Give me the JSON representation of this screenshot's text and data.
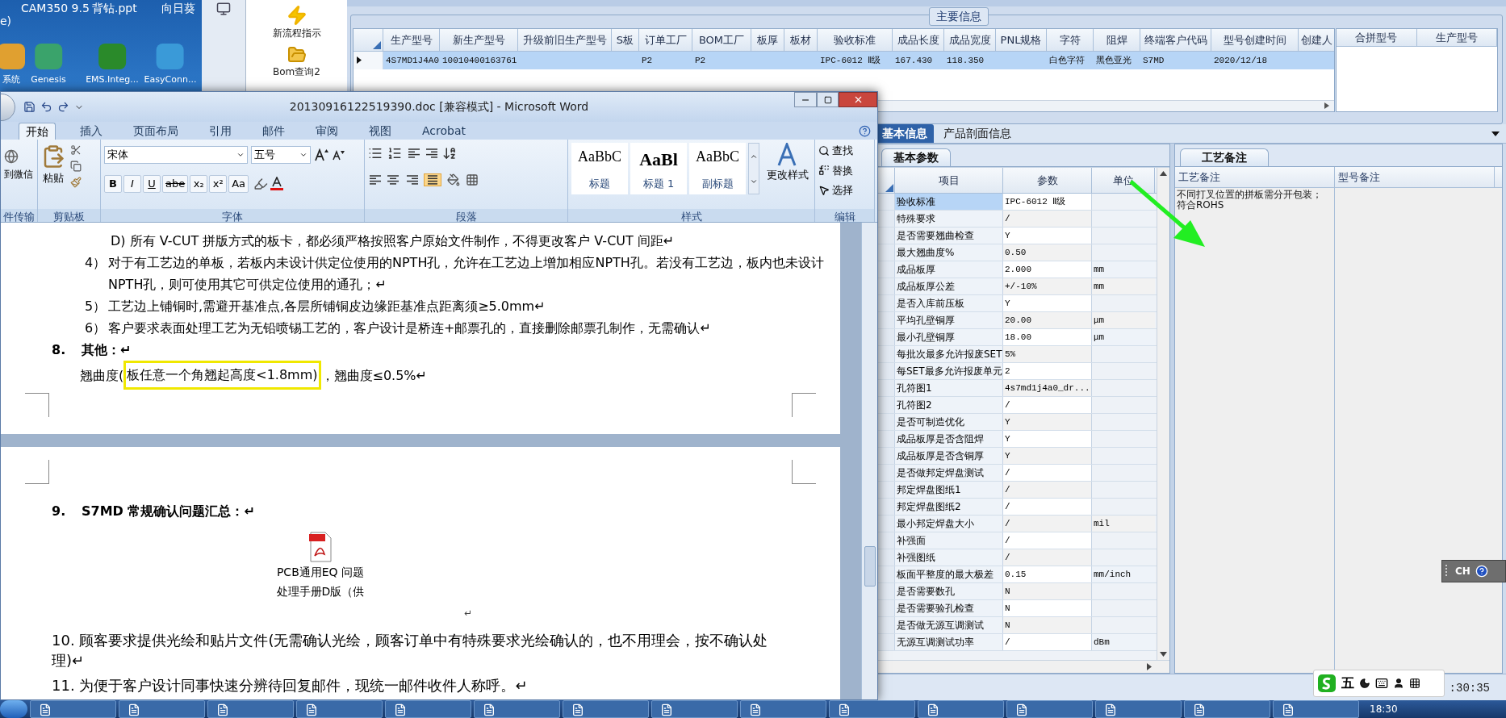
{
  "desktop": {
    "top_labels": [
      "e)",
      "CAM350 9.5",
      "背钻.ppt",
      "向日葵"
    ],
    "icons": [
      {
        "label": "系统"
      },
      {
        "label": "Genesis"
      },
      {
        "label": "EMS.Integ..."
      },
      {
        "label": "EasyConn..."
      }
    ]
  },
  "launcher": {
    "items": [
      {
        "label": "新流程指示"
      },
      {
        "label": "Bom查询2"
      }
    ]
  },
  "main_app": {
    "group_title": "主要信息",
    "main_table": {
      "columns": [
        "生产型号",
        "新生产型号",
        "升级前旧生产型号",
        "S板",
        "订单工厂",
        "BOM工厂",
        "板厚",
        "板材",
        "验收标准",
        "成品长度",
        "成品宽度",
        "PNL规格",
        "字符",
        "阻焊",
        "终端客户代码",
        "型号创建时间",
        "创建人"
      ],
      "rows": [
        {
          "selected": true,
          "cells": [
            "4S7MD1J4A0",
            "10010400163761",
            "",
            "",
            "P2",
            "P2",
            "",
            "",
            "IPC-6012 Ⅱ级",
            "167.430",
            "118.350",
            "",
            "白色字符",
            "黑色亚光",
            "S7MD",
            "2020/12/18",
            ""
          ]
        }
      ]
    },
    "side_table": {
      "columns": [
        "合拼型号",
        "生产型号"
      ]
    },
    "tabs": [
      {
        "label": "基本信息",
        "selected": true
      },
      {
        "label": "产品剖面信息",
        "selected": false
      }
    ],
    "params": {
      "tab": "基本参数",
      "columns": [
        "项目",
        "参数",
        "单位"
      ],
      "rows": [
        {
          "item": "验收标准",
          "value": "IPC-6012 Ⅱ级",
          "unit": "",
          "selected": true
        },
        {
          "item": "特殊要求",
          "value": "/",
          "unit": "",
          "selected": false
        },
        {
          "item": "是否需要翘曲检查",
          "value": "Y",
          "unit": "",
          "selected": false
        },
        {
          "item": "最大翘曲度%",
          "value": "0.50",
          "unit": "",
          "selected": false
        },
        {
          "item": "成品板厚",
          "value": "2.000",
          "unit": "mm",
          "selected": false
        },
        {
          "item": "成品板厚公差",
          "value": "+/-10%",
          "unit": "mm",
          "selected": false
        },
        {
          "item": "是否入库前压板",
          "value": "Y",
          "unit": "",
          "selected": false
        },
        {
          "item": "平均孔壁铜厚",
          "value": "20.00",
          "unit": "μm",
          "selected": false
        },
        {
          "item": "最小孔壁铜厚",
          "value": "18.00",
          "unit": "μm",
          "selected": false
        },
        {
          "item": "每批次最多允许报废SET",
          "value": "5%",
          "unit": "",
          "selected": false
        },
        {
          "item": "每SET最多允许报废单元",
          "value": "2",
          "unit": "",
          "selected": false
        },
        {
          "item": "孔符图1",
          "value": "4s7md1j4a0_dr...",
          "unit": "",
          "selected": false
        },
        {
          "item": "孔符图2",
          "value": "/",
          "unit": "",
          "selected": false
        },
        {
          "item": "是否可制造优化",
          "value": "Y",
          "unit": "",
          "selected": false
        },
        {
          "item": "成品板厚是否含阻焊",
          "value": "Y",
          "unit": "",
          "selected": false
        },
        {
          "item": "成品板厚是否含铜厚",
          "value": "Y",
          "unit": "",
          "selected": false
        },
        {
          "item": "是否做邦定焊盘测试",
          "value": "/",
          "unit": "",
          "selected": false
        },
        {
          "item": "邦定焊盘图纸1",
          "value": "/",
          "unit": "",
          "selected": false
        },
        {
          "item": "邦定焊盘图纸2",
          "value": "/",
          "unit": "",
          "selected": false
        },
        {
          "item": "最小邦定焊盘大小",
          "value": "/",
          "unit": "mil",
          "selected": false
        },
        {
          "item": "补强面",
          "value": "/",
          "unit": "",
          "selected": false
        },
        {
          "item": "补强图纸",
          "value": "/",
          "unit": "",
          "selected": false
        },
        {
          "item": "板面平整度的最大极差",
          "value": "0.15",
          "unit": "mm/inch",
          "selected": false
        },
        {
          "item": "是否需要数孔",
          "value": "N",
          "unit": "",
          "selected": false
        },
        {
          "item": "是否需要验孔检查",
          "value": "N",
          "unit": "",
          "selected": false
        },
        {
          "item": "是否做无源互调测试",
          "value": "N",
          "unit": "",
          "selected": false
        },
        {
          "item": "无源互调测试功率",
          "value": "/",
          "unit": "dBm",
          "selected": false
        }
      ]
    },
    "notes": {
      "tab": "工艺备注",
      "columns": [
        "工艺备注",
        "型号备注"
      ],
      "process_note": "不同打叉位置的拼板需分开包装；符合ROHS"
    },
    "status_time": ":30:35"
  },
  "word": {
    "title": "20130916122519390.doc [兼容模式] - Microsoft Word",
    "tabs": [
      {
        "label": "开始",
        "selected": true
      },
      {
        "label": "插入",
        "selected": false
      },
      {
        "label": "页面布局",
        "selected": false
      },
      {
        "label": "引用",
        "selected": false
      },
      {
        "label": "邮件",
        "selected": false
      },
      {
        "label": "审阅",
        "selected": false
      },
      {
        "label": "视图",
        "selected": false
      },
      {
        "label": "Acrobat",
        "selected": false
      }
    ],
    "share_button": "到微信",
    "paste_button": "粘贴",
    "font_name": "宋体",
    "font_size": "五号",
    "format_buttons": [
      "B",
      "I",
      "U",
      "abe",
      "x₂",
      "x²",
      "Aa"
    ],
    "styles": [
      {
        "preview": "AaBbC",
        "name": "标题"
      },
      {
        "preview": "AaBl",
        "name": "标题 1"
      },
      {
        "preview": "AaBbC",
        "name": "副标题"
      }
    ],
    "change_styles": "更改样式",
    "editing": [
      "查找",
      "替换",
      "选择"
    ],
    "group_labels": [
      "件传输",
      "剪贴板",
      "字体",
      "段落",
      "样式",
      "编辑"
    ],
    "page1": [
      {
        "kind": "sub",
        "text": "D) 所有 V-CUT 拼版方式的板卡，都必须严格按照客户原始文件制作，不得更改客户 V-CUT 间距↵"
      },
      {
        "kind": "item",
        "number": "4）",
        "text": "对于有工艺边的单板，若板内未设计供定位使用的NPTH孔，允许在工艺边上增加相应NPTH孔。若没有工艺边，板内也未设计NPTH孔，则可使用其它可供定位使用的通孔；↵"
      },
      {
        "kind": "item",
        "number": "5）",
        "text": "工艺边上铺铜时,需避开基准点,各层所铺铜皮边缘距基准点距离须≥5.0mm↵"
      },
      {
        "kind": "item",
        "number": "6）",
        "text": "客户要求表面处理工艺为无铅喷锡工艺的，客户设计是桥连+邮票孔的，直接删除邮票孔制作，无需确认↵"
      },
      {
        "kind": "heading",
        "number": "8.",
        "text": "其他：↵"
      },
      {
        "kind": "highlight",
        "parts": [
          "翘曲度(",
          "板任意一个角翘起高度<1.8mm)",
          "，翘曲度≤0.5%↵"
        ]
      }
    ],
    "page2": [
      {
        "kind": "heading",
        "number": "9.",
        "text": "S7MD 常规确认问题汇总：↵"
      },
      {
        "kind": "attachment",
        "caption": [
          "PCB通用EQ 问题",
          "处理手册D版（供"
        ]
      },
      {
        "kind": "mark",
        "text": "↵"
      },
      {
        "kind": "plain",
        "number": "10.",
        "text": "顾客要求提供光绘和贴片文件(无需确认光绘，顾客订单中有特殊要求光绘确认的，也不用理会，按不确认处理)↵"
      },
      {
        "kind": "plain",
        "number": "11.",
        "text": "为便于客户设计同事快速分辨待回复邮件，现统一邮件收件人称呼。↵"
      }
    ]
  },
  "language_bar": {
    "label": "CH"
  },
  "ime_bar": {
    "mode": "五"
  },
  "taskbar": {
    "clock": "18:30"
  }
}
